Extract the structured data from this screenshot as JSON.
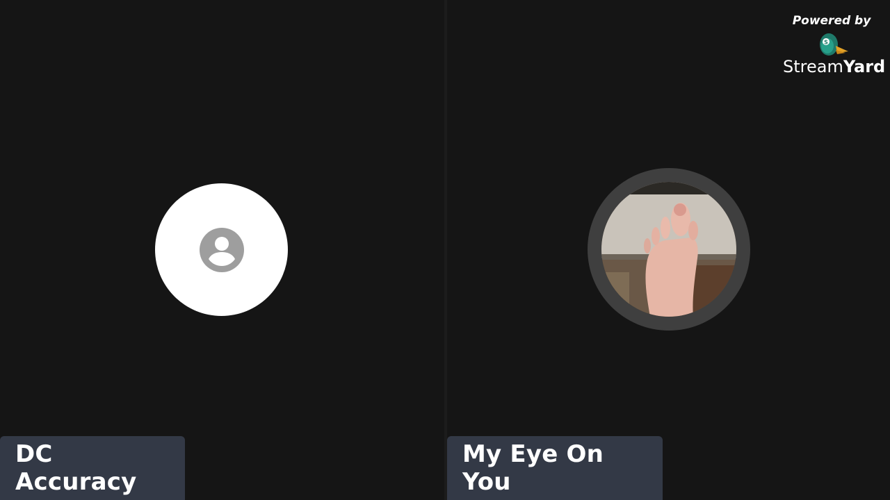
{
  "participants": [
    {
      "name": "DC Accuracy",
      "camera": "off",
      "avatar_icon": "person-icon"
    },
    {
      "name": "My Eye On You",
      "camera": "on"
    }
  ],
  "branding": {
    "powered_by": "Powered by",
    "name_part1": "Stream",
    "name_part2": "Yard",
    "logo_icon": "duck-logo-icon"
  },
  "colors": {
    "background": "#161616",
    "name_tag_bg": "#333946",
    "camera_ring": "#3f3f3f",
    "avatar_bg": "#ffffff",
    "avatar_icon": "#9e9e9e"
  }
}
